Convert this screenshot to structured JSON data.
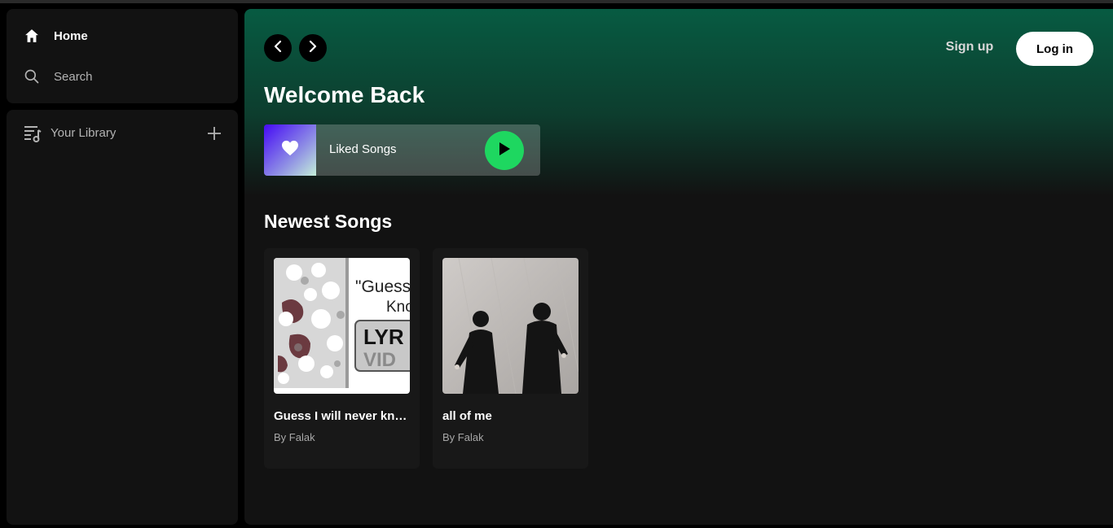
{
  "sidebar": {
    "home_label": "Home",
    "search_label": "Search",
    "library_label": "Your Library"
  },
  "header": {
    "signup_label": "Sign up",
    "login_label": "Log in"
  },
  "main": {
    "welcome_title": "Welcome Back",
    "liked_songs_label": "Liked Songs",
    "newest_section_title": "Newest Songs",
    "songs": [
      {
        "title": "Guess I will never know",
        "artist": "By Falak",
        "cover_text_1": "\"Guess I'",
        "cover_text_2": "Kno",
        "cover_text_3": "LYR",
        "cover_text_4": "VID"
      },
      {
        "title": "all of me",
        "artist": "By Falak"
      }
    ]
  },
  "colors": {
    "accent_green": "#1ed760",
    "header_gradient_top": "#075b42",
    "background": "#121212",
    "card_background": "#181818"
  },
  "icons": {
    "home": "home-icon",
    "search": "search-icon",
    "library": "library-icon",
    "plus": "plus-icon",
    "back": "chevron-left-icon",
    "forward": "chevron-right-icon",
    "heart": "heart-icon",
    "play": "play-icon"
  }
}
